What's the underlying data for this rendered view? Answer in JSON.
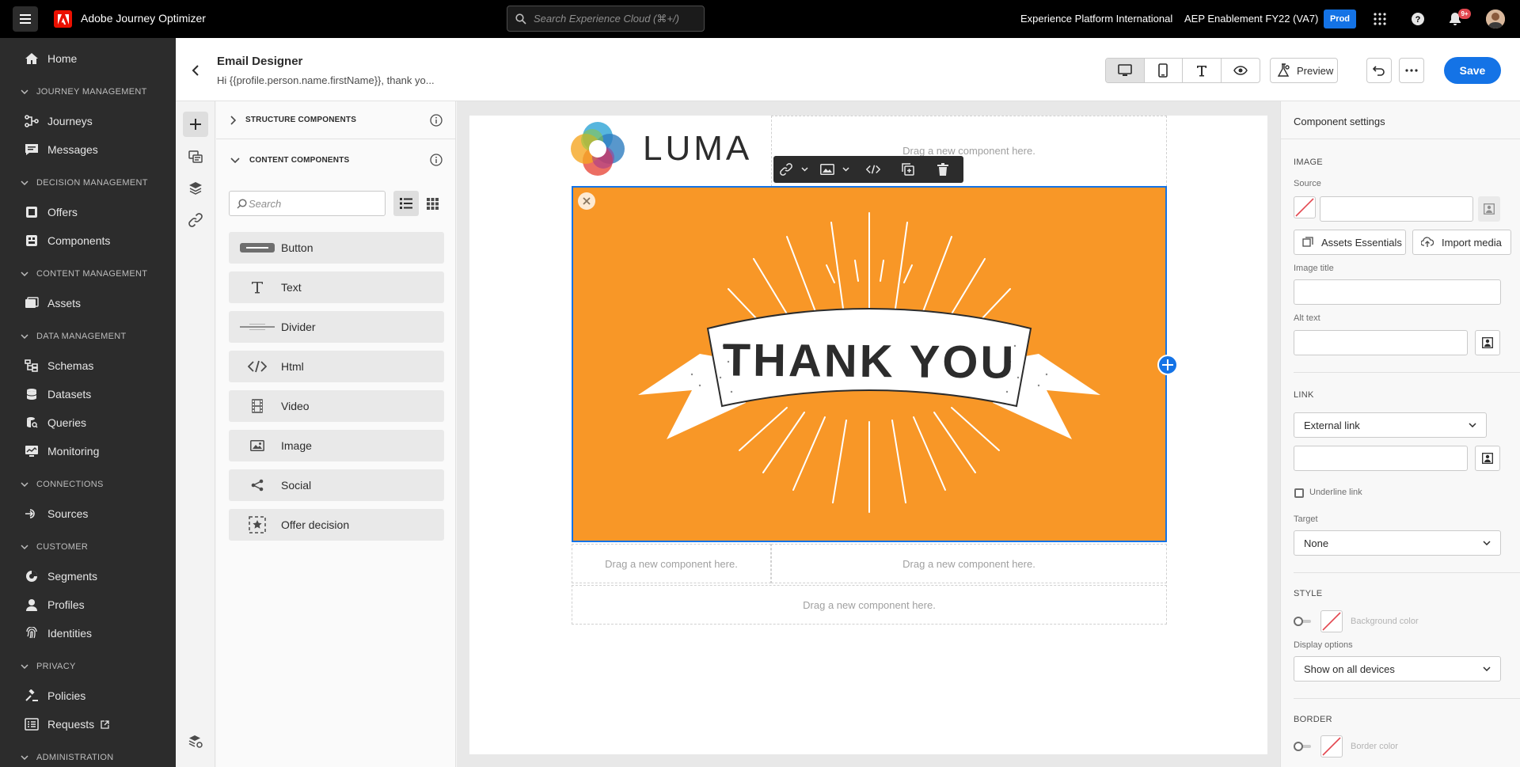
{
  "topbar": {
    "app_name": "Adobe Journey Optimizer",
    "search_placeholder": "Search Experience Cloud (⌘+/)",
    "org_name": "Experience Platform International",
    "sandbox_name": "AEP Enablement FY22 (VA7)",
    "env_badge": "Prod",
    "notifications_count": "9+"
  },
  "sidebar": {
    "home": "Home",
    "sections": {
      "journey": "JOURNEY MANAGEMENT",
      "decision": "DECISION MANAGEMENT",
      "content": "CONTENT MANAGEMENT",
      "data": "DATA MANAGEMENT",
      "connections": "CONNECTIONS",
      "customer": "CUSTOMER",
      "privacy": "PRIVACY",
      "administration": "ADMINISTRATION"
    },
    "items": {
      "journeys": "Journeys",
      "messages": "Messages",
      "offers": "Offers",
      "components": "Components",
      "assets": "Assets",
      "schemas": "Schemas",
      "datasets": "Datasets",
      "queries": "Queries",
      "monitoring": "Monitoring",
      "sources": "Sources",
      "segments": "Segments",
      "profiles": "Profiles",
      "identities": "Identities",
      "policies": "Policies",
      "requests": "Requests"
    }
  },
  "header": {
    "title": "Email Designer",
    "subject": "Hi {{profile.person.name.firstName}}, thank yo...",
    "preview_label": "Preview",
    "save_label": "Save"
  },
  "components_panel": {
    "structure_label": "STRUCTURE COMPONENTS",
    "content_label": "CONTENT COMPONENTS",
    "search_placeholder": "Search",
    "items": [
      "Button",
      "Text",
      "Divider",
      "Html",
      "Video",
      "Image",
      "Social",
      "Offer decision"
    ]
  },
  "canvas": {
    "logo_text": "LUMA",
    "image_text": "THANK YOU",
    "drop_hint": "Drag a new component here."
  },
  "settings": {
    "title": "Component settings",
    "image_section": "IMAGE",
    "source_label": "Source",
    "assets_button": "Assets Essentials",
    "import_button": "Import media",
    "image_title_label": "Image title",
    "alt_text_label": "Alt text",
    "link_section": "LINK",
    "link_type": "External link",
    "underline_label": "Underline link",
    "target_label": "Target",
    "target_value": "None",
    "style_section": "STYLE",
    "background_color_label": "Background color",
    "display_options_label": "Display options",
    "display_value": "Show on all devices",
    "border_section": "BORDER",
    "border_color_label": "Border color"
  },
  "colors": {
    "accent": "#1473e6",
    "image_background": "#f89727",
    "nav_background": "#2c2c2c",
    "topbar_background": "#000000"
  }
}
